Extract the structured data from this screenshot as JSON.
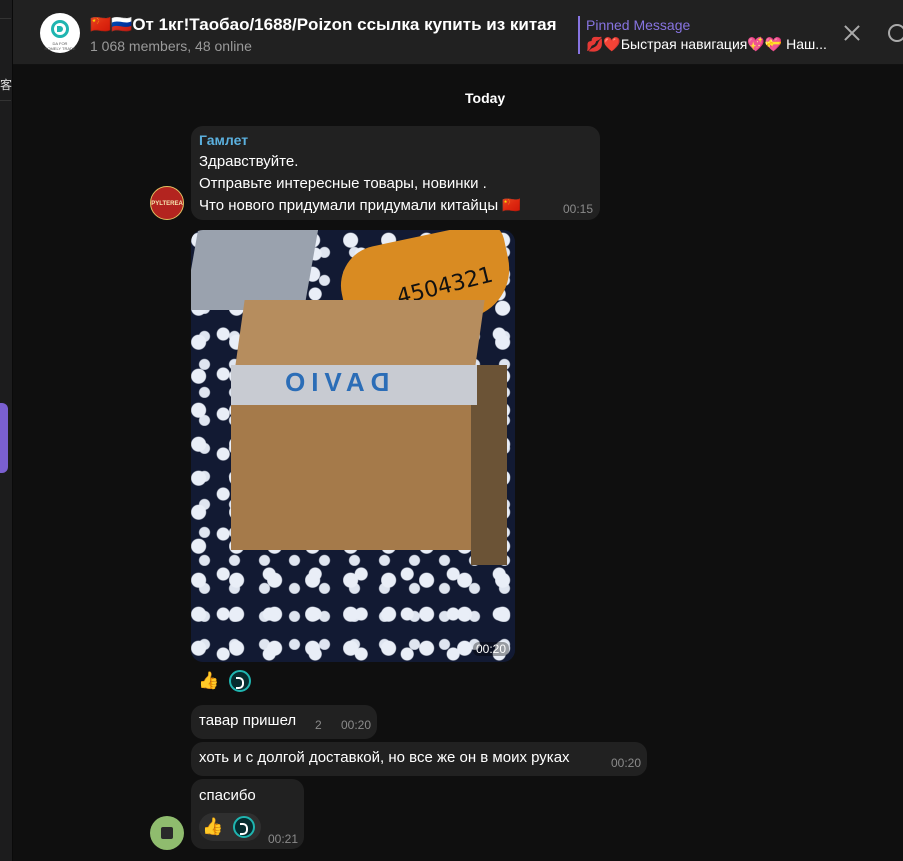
{
  "chatlist_fragment": {
    "text": "客"
  },
  "header": {
    "title": "🇨🇳🇷🇺От 1кг!Таобао/1688/Poizon ссылка купить из китая",
    "subtitle": "1 068 members, 48 online",
    "pinned_label": "Pinned Message",
    "pinned_text": "💋❤️Быстрая навигация💖💝 Наш...",
    "avatar_text": "DA FOR HOMELY TRADE"
  },
  "date_separator": "Today",
  "messages": [
    {
      "sender": "Гамлет",
      "lines": [
        "Здравствуйте.",
        "Отправьте интересные товары, новинки .",
        "Что нового придумали придумали китайцы 🇨🇳"
      ],
      "time": "00:15",
      "avatar_text": "PYLTEREA"
    },
    {
      "photo_text_tape": "DAVIO",
      "photo_text_package": "4504321",
      "time": "00:20",
      "reactions": [
        "👍"
      ]
    },
    {
      "text": "тавар пришел",
      "meta": "2",
      "time": "00:20"
    },
    {
      "text": "хоть и с долгой доставкой, но все же он в моих руках",
      "time": "00:20"
    },
    {
      "text": "спасибо",
      "time": "00:21",
      "reactions": [
        "👍"
      ]
    }
  ]
}
